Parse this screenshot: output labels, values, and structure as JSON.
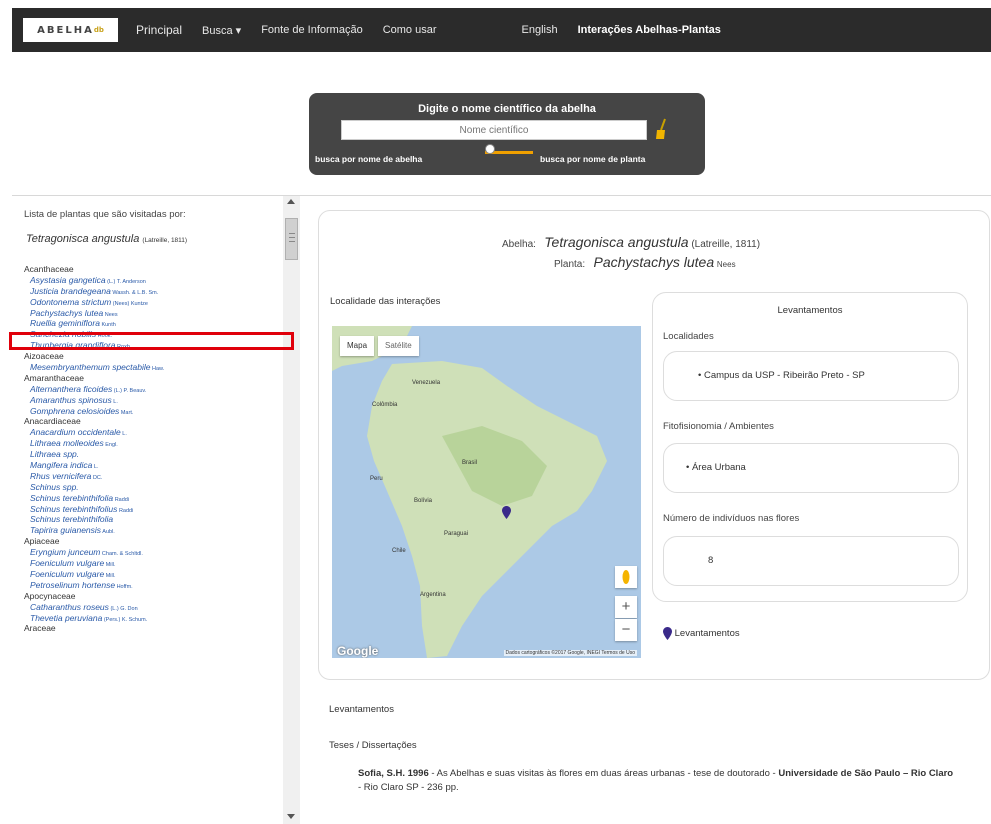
{
  "nav": {
    "logo": "ABELHA",
    "items": [
      "Principal",
      "Busca",
      "Fonte de Informação",
      "Como usar",
      "English",
      "Interações Abelhas-Plantas"
    ]
  },
  "search": {
    "title": "Digite o nome científico da abelha",
    "placeholder": "Nome científico",
    "toggle_left": "busca por nome de abelha",
    "toggle_right": "busca por nome de planta"
  },
  "sidebar": {
    "caption": "Lista de plantas que são visitadas por:",
    "bee": "Tetragonisca angustula",
    "bee_author": "(Latreille, 1811)",
    "plants": [
      {
        "t": "fam",
        "name": "Acanthaceae"
      },
      {
        "t": "sp",
        "name": "Asystasia gangetica",
        "author": "(L.) T. Anderson"
      },
      {
        "t": "sp",
        "name": "Justicia brandegeana",
        "author": "Wassh. & L.B. Sm."
      },
      {
        "t": "sp",
        "name": "Odontonema strictum",
        "author": "(Nees) Kuntze"
      },
      {
        "t": "sp",
        "name": "Pachystachys lutea",
        "author": "Nees"
      },
      {
        "t": "sp",
        "name": "Ruellia geminiflora",
        "author": "Kunth"
      },
      {
        "t": "sp",
        "name": "Sanchezia nobilis",
        "author": "Hook."
      },
      {
        "t": "sp",
        "name": "Thunbergia grandiflora",
        "author": "Roxb."
      },
      {
        "t": "fam",
        "name": "Aizoaceae"
      },
      {
        "t": "sp",
        "name": "Mesembryanthemum spectabile",
        "author": "Haw."
      },
      {
        "t": "fam",
        "name": "Amaranthaceae"
      },
      {
        "t": "sp",
        "name": "Alternanthera ficoides",
        "author": "(L.) P. Beauv."
      },
      {
        "t": "sp",
        "name": "Amaranthus spinosus",
        "author": "L."
      },
      {
        "t": "sp",
        "name": "Gomphrena celosioides",
        "author": "Mart."
      },
      {
        "t": "fam",
        "name": "Anacardiaceae"
      },
      {
        "t": "sp",
        "name": "Anacardium occidentale",
        "author": "L."
      },
      {
        "t": "sp",
        "name": "Lithraea molleoides",
        "author": "Engl."
      },
      {
        "t": "sp",
        "name": "Lithraea spp.",
        "author": ""
      },
      {
        "t": "sp",
        "name": "Mangifera indica",
        "author": "L."
      },
      {
        "t": "sp",
        "name": "Rhus vernicifera",
        "author": "DC."
      },
      {
        "t": "sp",
        "name": "Schinus spp.",
        "author": ""
      },
      {
        "t": "sp",
        "name": "Schinus terebinthifolia",
        "author": "Raddi"
      },
      {
        "t": "sp",
        "name": "Schinus terebinthifolius",
        "author": "Raddi"
      },
      {
        "t": "sp",
        "name": "Schinus terebinthifolia",
        "author": ""
      },
      {
        "t": "sp",
        "name": "Tapirira guianensis",
        "author": "Aubl."
      },
      {
        "t": "fam",
        "name": "Apiaceae"
      },
      {
        "t": "sp",
        "name": "Eryngium junceum",
        "author": "Cham. & Schltdl."
      },
      {
        "t": "sp",
        "name": "Foeniculum vulgare",
        "author": "Mill."
      },
      {
        "t": "sp",
        "name": "Foeniculum vulgare",
        "author": "Mill."
      },
      {
        "t": "sp",
        "name": "Petroselinum hortense",
        "author": "Hoffm."
      },
      {
        "t": "fam",
        "name": "Apocynaceae"
      },
      {
        "t": "sp",
        "name": "Catharanthus roseus",
        "author": "(L.) G. Don"
      },
      {
        "t": "sp",
        "name": "Thevetia peruviana",
        "author": "(Pers.) K. Schum."
      },
      {
        "t": "fam",
        "name": "Araceae"
      }
    ]
  },
  "detail": {
    "bee_label": "Abelha:",
    "bee_name": "Tetragonisca angustula",
    "bee_author": "(Latreille, 1811)",
    "plant_label": "Planta:",
    "plant_name": "Pachystachys lutea",
    "plant_author": "Nees",
    "locality_heading": "Localidade das interações"
  },
  "map": {
    "tab_map": "Mapa",
    "tab_sat": "Satélite",
    "zoom_in": "+",
    "zoom_out": "−",
    "google": "Google",
    "footer": "Dados cartográficos ©2017 Google, INEGI  Termos de Uso",
    "labels": [
      "Venezuela",
      "Colômbia",
      "Peru",
      "Brasil",
      "Bolívia",
      "Paraguai",
      "Chile",
      "Argentina"
    ]
  },
  "surveys": {
    "title": "Levantamentos",
    "localidades_label": "Localidades",
    "localidade": "• Campus da USP - Ribeirão Preto - SP",
    "fito_label": "Fitofisionomia / Ambientes",
    "fito": "• Área Urbana",
    "individuos_label": "Número de indivíduos nas flores",
    "individuos": "8",
    "legend": "Levantamentos"
  },
  "footer": {
    "lev": "Levantamentos",
    "teses": "Teses / Dissertações",
    "ref_author": "Sofia, S.H. 1996",
    "ref_body": " - As Abelhas e suas visitas às flores em duas áreas urbanas - tese de doutorado - ",
    "ref_inst": "Universidade de São Paulo – Rio Claro",
    "ref_tail": " - Rio Claro SP - 236 pp."
  },
  "colors": {
    "highlight": "#e0000b",
    "pin": "#3a2a8a",
    "toggle": "#f0a000"
  }
}
